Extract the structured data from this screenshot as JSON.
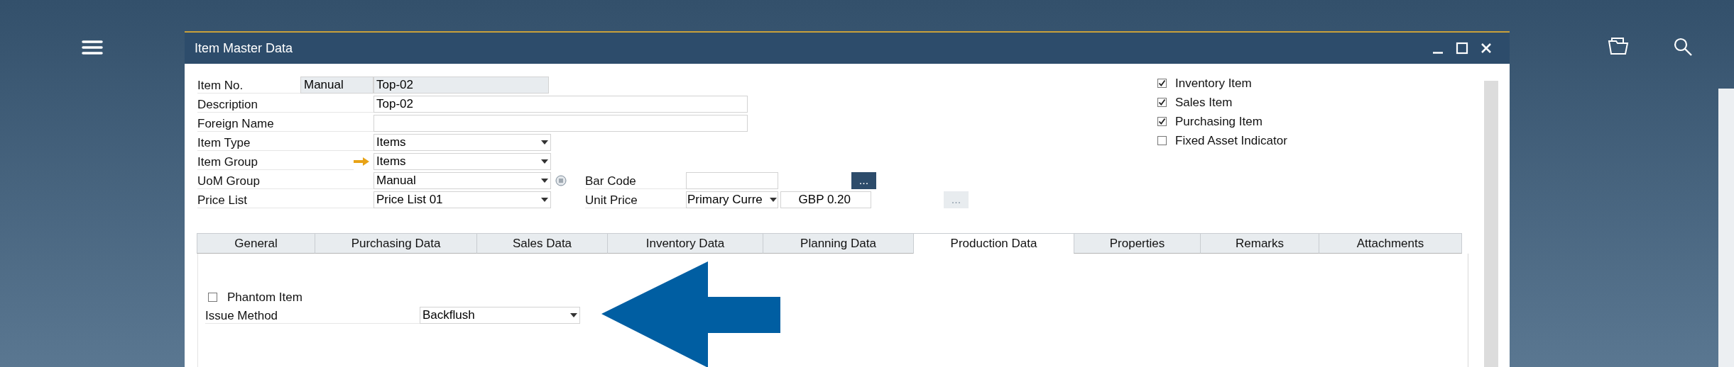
{
  "window": {
    "title": "Item Master Data"
  },
  "fields": [
    {
      "kind": "numbered",
      "label": "Item No.",
      "series": "Manual",
      "value": "Top-02"
    },
    {
      "kind": "text",
      "label": "Description",
      "value": "Top-02"
    },
    {
      "kind": "text",
      "label": "Foreign Name"
    },
    {
      "kind": "dropdown",
      "label": "Item Type",
      "value": "Items"
    },
    {
      "kind": "dropdown",
      "label": "Item Group",
      "value": "Items",
      "link": true
    },
    {
      "kind": "dropdown",
      "label": "UoM Group",
      "value": "Manual",
      "detail": true,
      "side": {
        "kind": "barcode",
        "label": "Bar Code",
        "button": "..."
      }
    },
    {
      "kind": "dropdown",
      "label": "Price List",
      "value": "Price List 01",
      "side": {
        "kind": "price",
        "label": "Unit Price",
        "currency": "Primary Curre",
        "value": "GBP 0.20",
        "button": "..."
      }
    }
  ],
  "checkboxes": [
    {
      "label": "Inventory Item",
      "checked": true
    },
    {
      "label": "Sales Item",
      "checked": true
    },
    {
      "label": "Purchasing Item",
      "checked": true
    },
    {
      "label": "Fixed Asset Indicator",
      "checked": false
    }
  ],
  "tabs": [
    {
      "label": "General",
      "selected": false
    },
    {
      "label": "Purchasing Data",
      "selected": false
    },
    {
      "label": "Sales Data",
      "selected": false
    },
    {
      "label": "Inventory Data",
      "selected": false
    },
    {
      "label": "Planning Data",
      "selected": false
    },
    {
      "label": "Production Data",
      "selected": true
    },
    {
      "label": "Properties",
      "selected": false
    },
    {
      "label": "Remarks",
      "selected": false
    },
    {
      "label": "Attachments",
      "selected": false
    }
  ],
  "production": {
    "phantom_item": {
      "label": "Phantom Item",
      "checked": false
    },
    "issue_method": {
      "label": "Issue Method",
      "value": "Backflush"
    }
  }
}
